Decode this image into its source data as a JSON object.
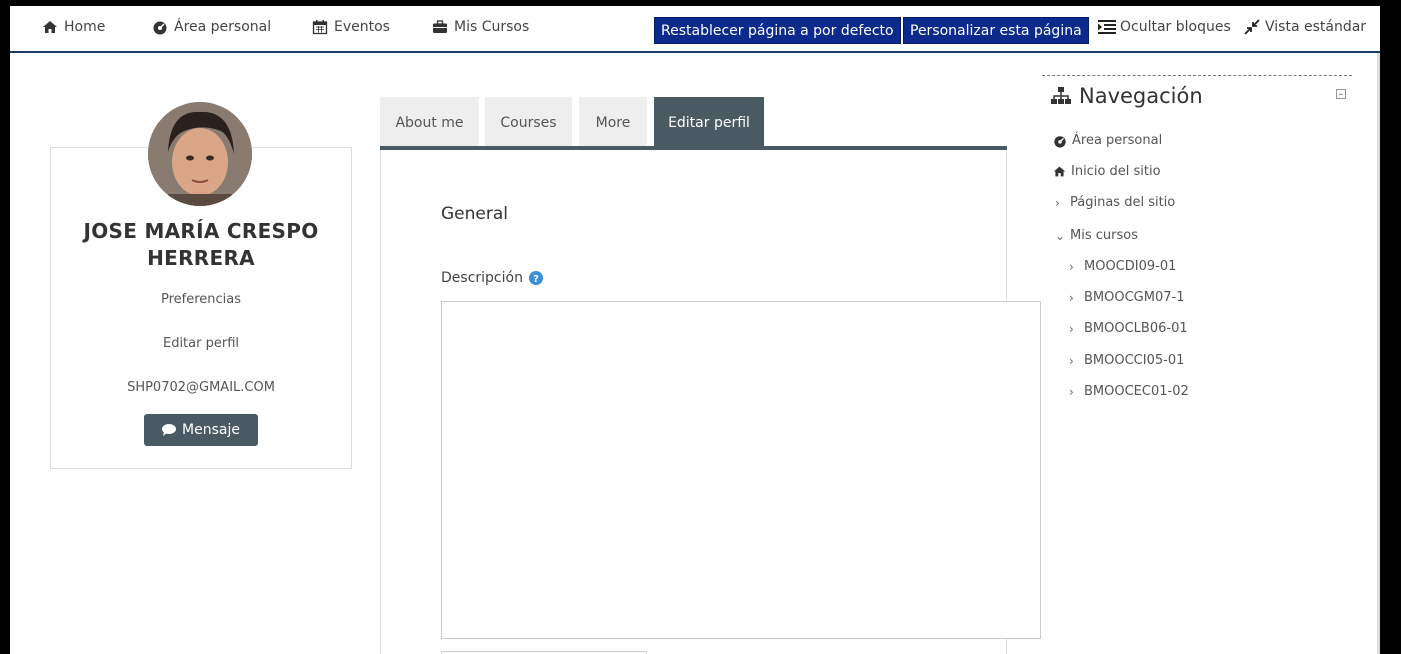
{
  "topnav": {
    "home": "Home",
    "area_personal": "Área personal",
    "eventos": "Eventos",
    "mis_cursos": "Mis Cursos",
    "reset_btn": "Restablecer página a por defecto",
    "customize_btn": "Personalizar esta página",
    "hide_blocks": "Ocultar bloques",
    "standard_view": "Vista estándar"
  },
  "profile": {
    "name_line1": "JOSE MARÍA CRESPO",
    "name_line2": "HERRERA",
    "preferences": "Preferencias",
    "edit_profile": "Editar perfil",
    "email": "SHP0702@GMAIL.COM",
    "message_btn": "Mensaje"
  },
  "tabs": [
    {
      "label": "About me"
    },
    {
      "label": "Courses"
    },
    {
      "label": "More"
    },
    {
      "label": "Editar perfil",
      "active": true
    }
  ],
  "form": {
    "section_title": "General",
    "description_label": "Descripción"
  },
  "navigation": {
    "title": "Navegación",
    "items": [
      {
        "label": "Área personal"
      },
      {
        "label": "Inicio del sitio"
      },
      {
        "label": "Páginas del sitio"
      },
      {
        "label": "Mis cursos"
      }
    ],
    "courses": [
      "MOOCDI09-01",
      "BMOOCGM07-1",
      "BMOOCLB06-01",
      "BMOOCCI05-01",
      "BMOOCEC01-02"
    ]
  },
  "colors": {
    "primary_button": "#0b2a8c",
    "tab_active": "#4a5a63",
    "nav_rule": "#1a3b6b"
  }
}
